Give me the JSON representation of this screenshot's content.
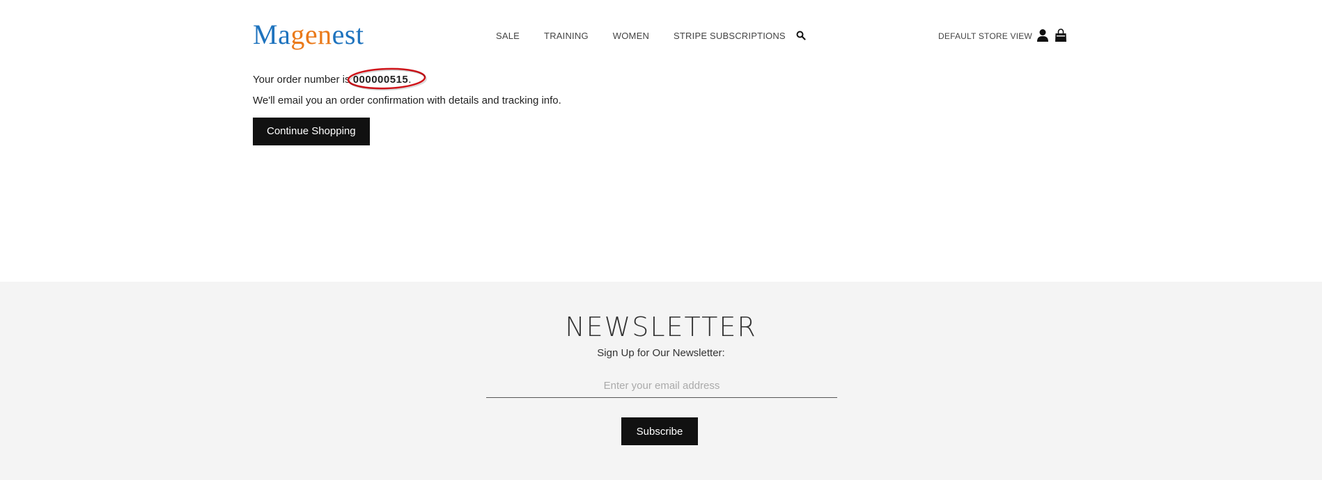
{
  "header": {
    "logo": {
      "part1": "Ma",
      "part2": "gen",
      "part3": "est"
    },
    "nav": [
      {
        "label": "SALE"
      },
      {
        "label": "TRAINING"
      },
      {
        "label": "WOMEN"
      },
      {
        "label": "STRIPE SUBSCRIPTIONS"
      }
    ],
    "store_view": "DEFAULT STORE VIEW"
  },
  "main": {
    "order_prefix": "Your order number is ",
    "order_number": "000000515",
    "order_suffix": ".",
    "confirmation_text": "We'll email you an order confirmation with details and tracking info.",
    "continue_label": "Continue Shopping"
  },
  "footer": {
    "title": "NEWSLETTER",
    "subtitle": "Sign Up for Our Newsletter:",
    "email_placeholder": "Enter your email address",
    "subscribe_label": "Subscribe"
  },
  "icons": [
    "search-icon",
    "user-icon",
    "cart-icon"
  ],
  "colors": {
    "logo_blue": "#1e73be",
    "logo_orange": "#ea7a1a",
    "button_bg": "#111111",
    "footer_bg": "#f4f4f4",
    "highlight_ring": "#d0141a"
  }
}
